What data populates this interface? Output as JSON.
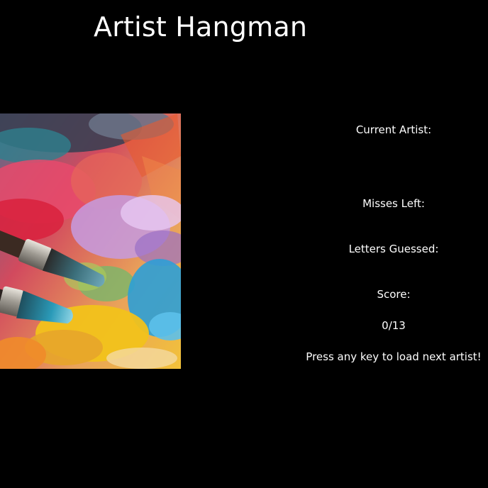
{
  "header": {
    "title": "Artist Hangman"
  },
  "artwork": {
    "icon": "paint-palette-brushes-image"
  },
  "game": {
    "current_artist_label": "Current Artist:",
    "current_artist_value": "",
    "misses_left_label": "Misses Left:",
    "misses_left_value": "",
    "letters_guessed_label": "Letters Guessed:",
    "letters_guessed_value": "",
    "score_label": "Score:",
    "score_value": "0/13",
    "instruction": "Press any key to load next artist!"
  }
}
